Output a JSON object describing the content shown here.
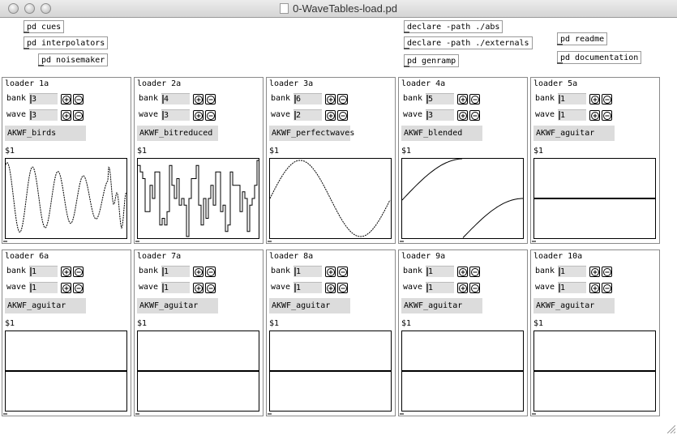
{
  "window": {
    "title": "0-WaveTables-load.pd"
  },
  "objects": {
    "pd_cues": "pd cues",
    "pd_interpolators": "pd interpolators",
    "pd_noisemaker": "pd noisemaker",
    "declare_abs": "declare -path ./abs",
    "declare_externals": "declare -path ./externals",
    "pd_genramp": "pd genramp",
    "pd_readme": "pd readme",
    "pd_documentation": "pd documentation"
  },
  "labels": {
    "bank": "bank",
    "wave": "wave",
    "arg": "$1",
    "plus_icon": "plus-icon",
    "minus_icon": "minus-icon"
  },
  "loaders": [
    {
      "title": "loader 1a",
      "bank": "3",
      "wave": "3",
      "name": "AKWF_birds",
      "waveform": "birds"
    },
    {
      "title": "loader 2a",
      "bank": "4",
      "wave": "3",
      "name": "AKWF_bitreduced",
      "waveform": "bitreduced"
    },
    {
      "title": "loader 3a",
      "bank": "6",
      "wave": "2",
      "name": "AKWF_perfectwaves",
      "waveform": "sine"
    },
    {
      "title": "loader 4a",
      "bank": "5",
      "wave": "3",
      "name": "AKWF_blended",
      "waveform": "blended"
    },
    {
      "title": "loader 5a",
      "bank": "1",
      "wave": "1",
      "name": "AKWF_aguitar",
      "waveform": "flat"
    },
    {
      "title": "loader 6a",
      "bank": "1",
      "wave": "1",
      "name": "AKWF_aguitar",
      "waveform": "flat"
    },
    {
      "title": "loader 7a",
      "bank": "1",
      "wave": "1",
      "name": "AKWF_aguitar",
      "waveform": "flat"
    },
    {
      "title": "loader 8a",
      "bank": "1",
      "wave": "1",
      "name": "AKWF_aguitar",
      "waveform": "flat"
    },
    {
      "title": "loader 9a",
      "bank": "1",
      "wave": "1",
      "name": "AKWF_aguitar",
      "waveform": "flat"
    },
    {
      "title": "loader 10a",
      "bank": "1",
      "wave": "1",
      "name": "AKWF_aguitar",
      "waveform": "flat"
    }
  ]
}
